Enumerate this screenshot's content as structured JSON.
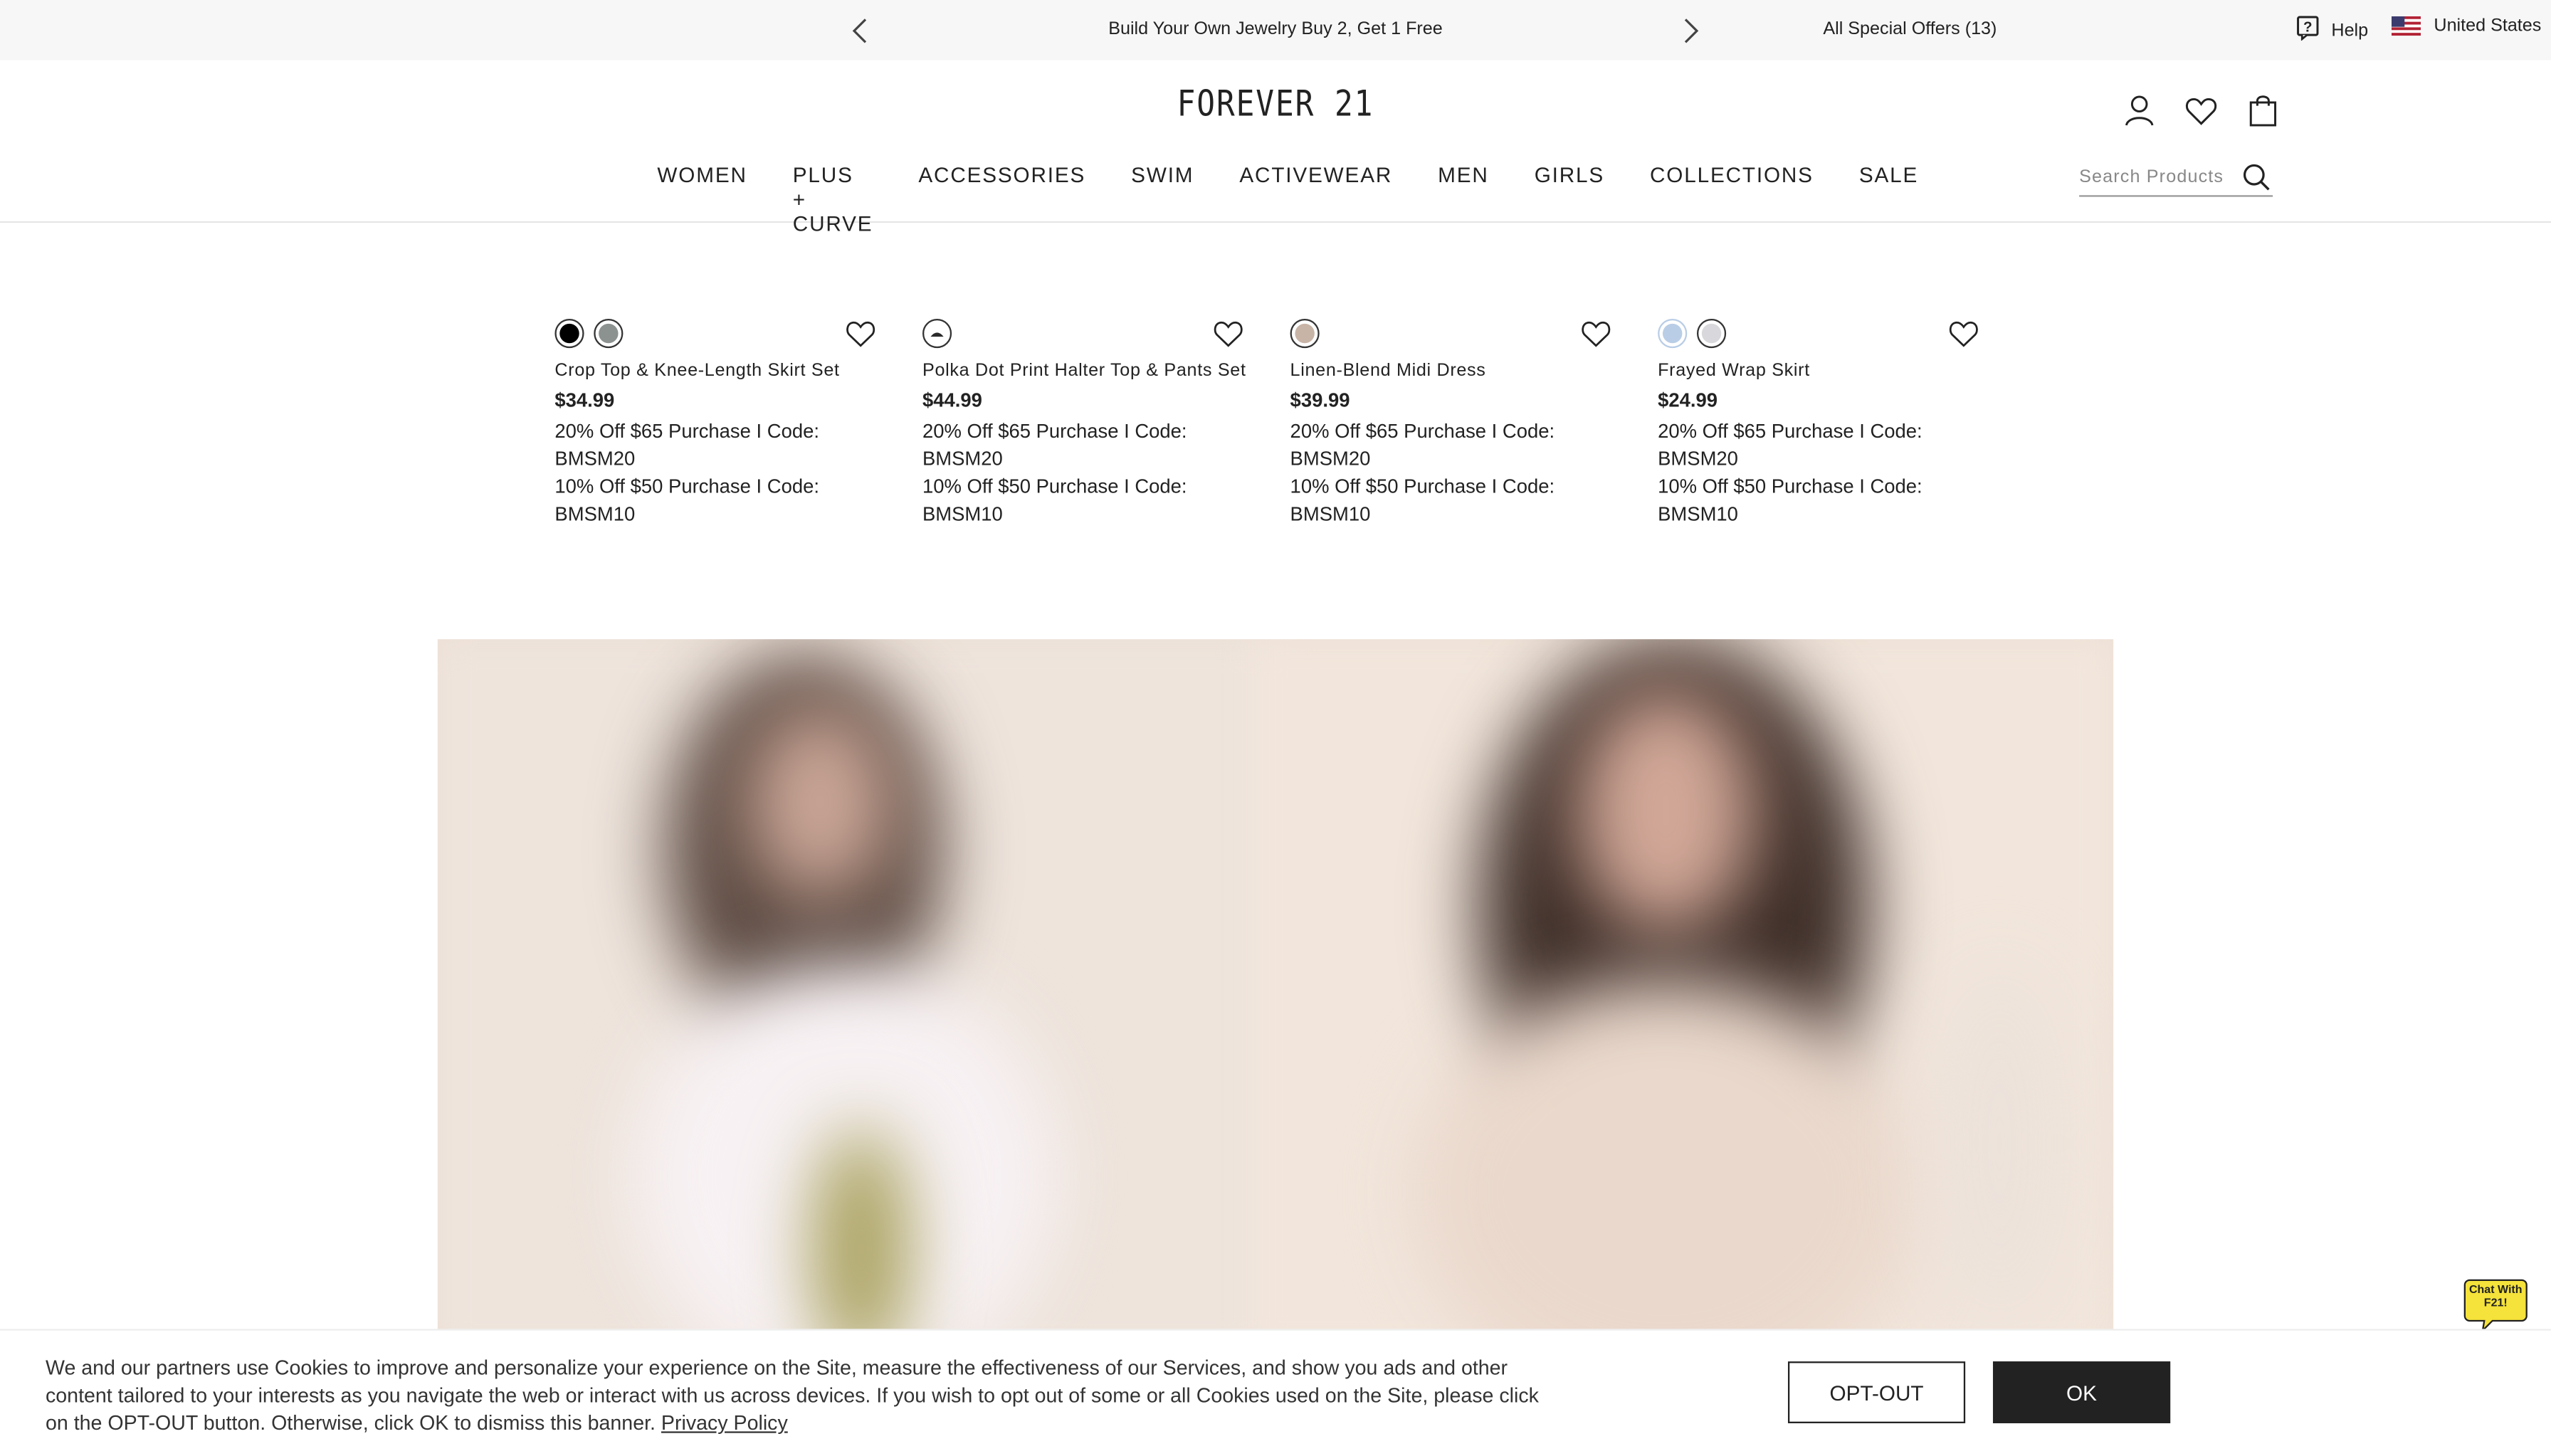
{
  "promo_bar": {
    "message": "Build Your Own Jewelry Buy 2, Get 1 Free",
    "special_offers": "All Special Offers (13)",
    "help": "Help",
    "country": "United States"
  },
  "header": {
    "logo": "FOREVER 21",
    "nav": [
      "WOMEN",
      "PLUS + CURVE",
      "ACCESSORIES",
      "SWIM",
      "ACTIVEWEAR",
      "MEN",
      "GIRLS",
      "COLLECTIONS",
      "SALE"
    ],
    "search_placeholder": "Search Products"
  },
  "products": [
    {
      "name": "Crop Top & Knee-Length Skirt Set",
      "price": "$34.99",
      "swatches": [
        "#000000",
        "#8c9290"
      ],
      "promo_1": "20% Off $65 Purchase I Code: BMSM20",
      "promo_2": "10% Off $50 Purchase I Code: BMSM10"
    },
    {
      "name": "Polka Dot Print Halter Top & Pants Set",
      "price": "$44.99",
      "swatches": [
        "#2a2a2a"
      ],
      "promo_1": "20% Off $65 Purchase I Code: BMSM20",
      "promo_2": "10% Off $50 Purchase I Code: BMSM10"
    },
    {
      "name": "Linen-Blend Midi Dress",
      "price": "$39.99",
      "swatches": [
        "#c8b4a6"
      ],
      "promo_1": "20% Off $65 Purchase I Code: BMSM20",
      "promo_2": "10% Off $50 Purchase I Code: BMSM10"
    },
    {
      "name": "Frayed Wrap Skirt",
      "price": "$24.99",
      "swatches": [
        "#b9cde6",
        "#d8d8dc"
      ],
      "promo_1": "20% Off $65 Purchase I Code: BMSM20",
      "promo_2": "10% Off $50 Purchase I Code: BMSM10"
    }
  ],
  "cookie_banner": {
    "text": "We and our partners use Cookies to improve and personalize your experience on the Site, measure the effectiveness of our Services, and show you ads and other content tailored to your interests as you navigate the web or interact with us across devices. If you wish to opt out of some or all Cookies used on the Site, please click on the OPT-OUT button. Otherwise, click OK to dismiss this banner.",
    "privacy_link": "Privacy Policy",
    "optout_label": "OPT-OUT",
    "ok_label": "OK"
  },
  "chat": {
    "label": "Chat With F21!"
  },
  "colors": {
    "chat_bubble": "#f5e23a",
    "dark": "#222222",
    "promo_bg": "#f7f7f7"
  }
}
